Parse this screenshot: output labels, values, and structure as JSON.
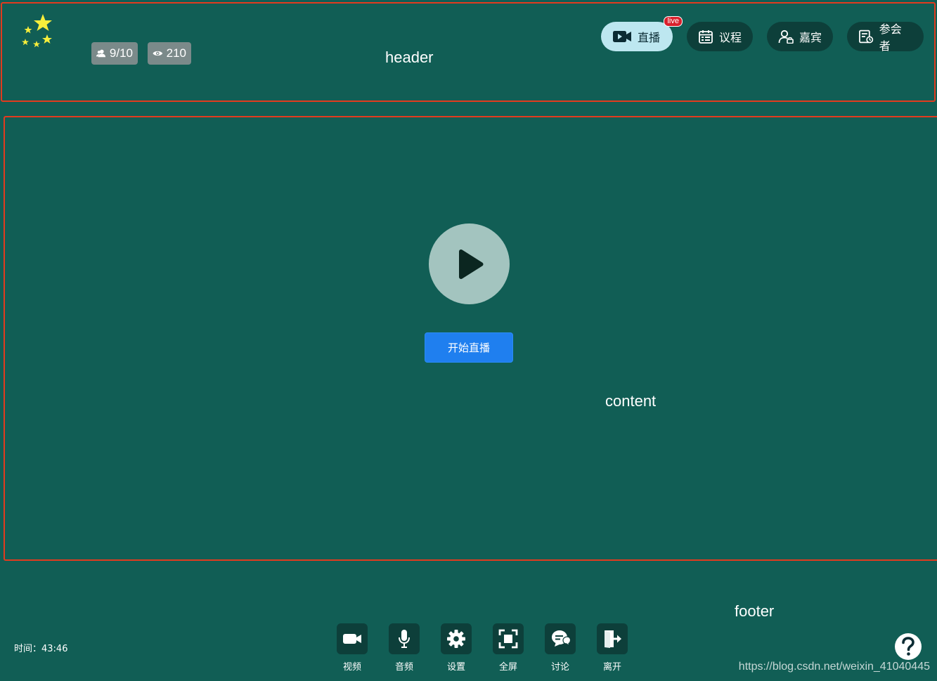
{
  "annotations": {
    "header_label": "header",
    "content_label": "content",
    "footer_label": "footer"
  },
  "header": {
    "stats": {
      "participants": "9/10",
      "views": "210"
    },
    "nav": [
      {
        "label": "直播",
        "icon": "video-camera-icon",
        "active": true,
        "badge": "live"
      },
      {
        "label": "议程",
        "icon": "calendar-icon",
        "active": false
      },
      {
        "label": "嘉宾",
        "icon": "guest-icon",
        "active": false
      },
      {
        "label": "参会者",
        "icon": "attendee-icon",
        "active": false
      }
    ]
  },
  "content": {
    "start_button_label": "开始直播"
  },
  "footer": {
    "timer": "时间：43:46",
    "tools": [
      {
        "label": "视频",
        "icon": "video-icon"
      },
      {
        "label": "音频",
        "icon": "microphone-icon"
      },
      {
        "label": "设置",
        "icon": "gear-icon"
      },
      {
        "label": "全屏",
        "icon": "fullscreen-icon"
      },
      {
        "label": "讨论",
        "icon": "chat-icon"
      },
      {
        "label": "离开",
        "icon": "exit-icon"
      }
    ],
    "watermark": "https://blog.csdn.net/weixin_41040445"
  },
  "colors": {
    "background": "#115e55",
    "region_outline": "#e23b1e",
    "active_pill": "#bde7f0",
    "pill": "#0d3f3a",
    "primary_button": "#1f7fef",
    "live_badge": "#d8202c"
  }
}
